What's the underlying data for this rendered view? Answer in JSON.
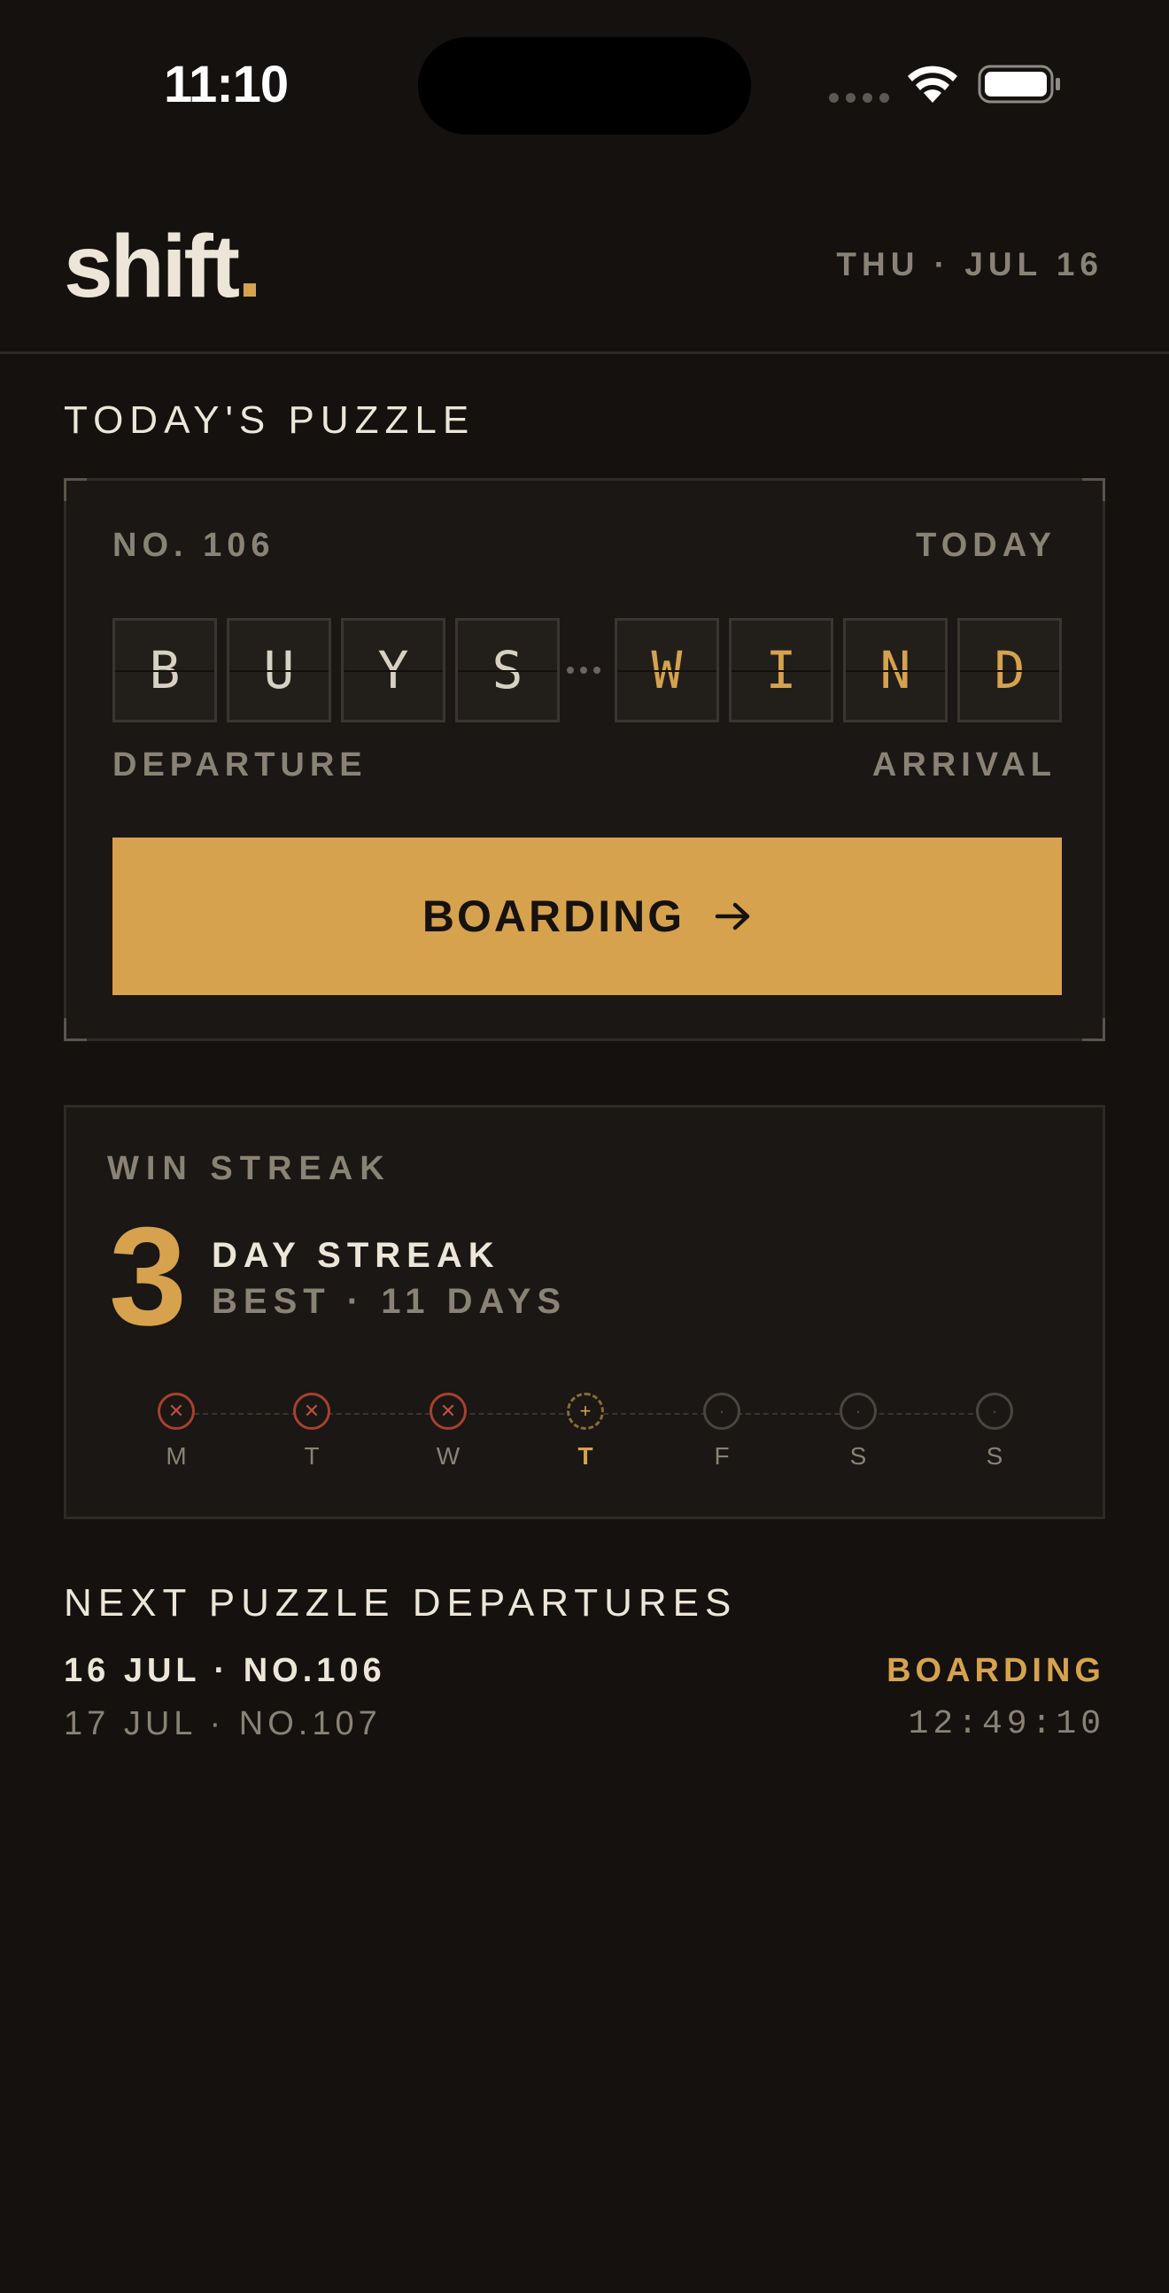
{
  "status_bar": {
    "time": "11:10"
  },
  "header": {
    "logo_text": "shift",
    "logo_dot": ".",
    "date": "THU · JUL 16"
  },
  "todays_puzzle": {
    "section_title": "TODAY'S PUZZLE",
    "number": "NO. 106",
    "when": "TODAY",
    "departure_tiles": [
      "B",
      "U",
      "Y",
      "S"
    ],
    "arrival_tiles": [
      "W",
      "I",
      "N",
      "D"
    ],
    "departure_label": "DEPARTURE",
    "arrival_label": "ARRIVAL",
    "button_label": "BOARDING"
  },
  "streak": {
    "title": "WIN STREAK",
    "count": "3",
    "label": "DAY STREAK",
    "best": "BEST · 11 DAYS",
    "days": [
      {
        "letter": "M",
        "state": "missed",
        "symbol": "✕"
      },
      {
        "letter": "T",
        "state": "missed",
        "symbol": "✕"
      },
      {
        "letter": "W",
        "state": "missed",
        "symbol": "✕"
      },
      {
        "letter": "T",
        "state": "today",
        "symbol": "+"
      },
      {
        "letter": "F",
        "state": "future",
        "symbol": "·"
      },
      {
        "letter": "S",
        "state": "future",
        "symbol": "·"
      },
      {
        "letter": "S",
        "state": "future",
        "symbol": "·"
      }
    ]
  },
  "departures": {
    "section_title": "NEXT PUZZLE DEPARTURES",
    "rows": [
      {
        "left": "16 JUL · NO.106",
        "right": "BOARDING"
      },
      {
        "left": "17 JUL · NO.107",
        "right": "12:49:10"
      }
    ]
  },
  "colors": {
    "accent": "#d6a24e",
    "background": "#14110e",
    "missed": "#c0503b"
  }
}
